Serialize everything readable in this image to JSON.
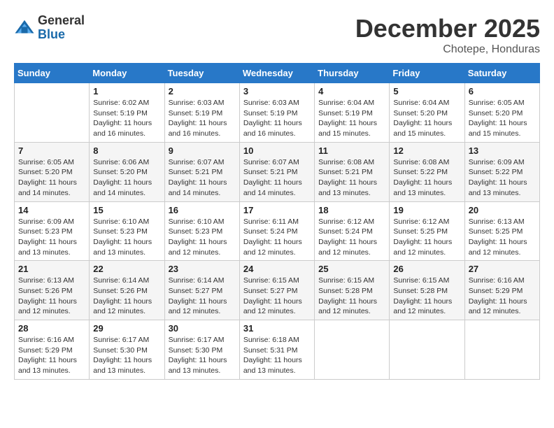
{
  "header": {
    "logo": {
      "general": "General",
      "blue": "Blue"
    },
    "title": "December 2025",
    "subtitle": "Chotepe, Honduras"
  },
  "calendar": {
    "days_of_week": [
      "Sunday",
      "Monday",
      "Tuesday",
      "Wednesday",
      "Thursday",
      "Friday",
      "Saturday"
    ],
    "weeks": [
      [
        {
          "day": "",
          "empty": true
        },
        {
          "day": "1",
          "sunrise": "6:02 AM",
          "sunset": "5:19 PM",
          "daylight": "11 hours and 16 minutes."
        },
        {
          "day": "2",
          "sunrise": "6:03 AM",
          "sunset": "5:19 PM",
          "daylight": "11 hours and 16 minutes."
        },
        {
          "day": "3",
          "sunrise": "6:03 AM",
          "sunset": "5:19 PM",
          "daylight": "11 hours and 16 minutes."
        },
        {
          "day": "4",
          "sunrise": "6:04 AM",
          "sunset": "5:19 PM",
          "daylight": "11 hours and 15 minutes."
        },
        {
          "day": "5",
          "sunrise": "6:04 AM",
          "sunset": "5:20 PM",
          "daylight": "11 hours and 15 minutes."
        },
        {
          "day": "6",
          "sunrise": "6:05 AM",
          "sunset": "5:20 PM",
          "daylight": "11 hours and 15 minutes."
        }
      ],
      [
        {
          "day": "7",
          "sunrise": "6:05 AM",
          "sunset": "5:20 PM",
          "daylight": "11 hours and 14 minutes."
        },
        {
          "day": "8",
          "sunrise": "6:06 AM",
          "sunset": "5:20 PM",
          "daylight": "11 hours and 14 minutes."
        },
        {
          "day": "9",
          "sunrise": "6:07 AM",
          "sunset": "5:21 PM",
          "daylight": "11 hours and 14 minutes."
        },
        {
          "day": "10",
          "sunrise": "6:07 AM",
          "sunset": "5:21 PM",
          "daylight": "11 hours and 14 minutes."
        },
        {
          "day": "11",
          "sunrise": "6:08 AM",
          "sunset": "5:21 PM",
          "daylight": "11 hours and 13 minutes."
        },
        {
          "day": "12",
          "sunrise": "6:08 AM",
          "sunset": "5:22 PM",
          "daylight": "11 hours and 13 minutes."
        },
        {
          "day": "13",
          "sunrise": "6:09 AM",
          "sunset": "5:22 PM",
          "daylight": "11 hours and 13 minutes."
        }
      ],
      [
        {
          "day": "14",
          "sunrise": "6:09 AM",
          "sunset": "5:23 PM",
          "daylight": "11 hours and 13 minutes."
        },
        {
          "day": "15",
          "sunrise": "6:10 AM",
          "sunset": "5:23 PM",
          "daylight": "11 hours and 13 minutes."
        },
        {
          "day": "16",
          "sunrise": "6:10 AM",
          "sunset": "5:23 PM",
          "daylight": "11 hours and 12 minutes."
        },
        {
          "day": "17",
          "sunrise": "6:11 AM",
          "sunset": "5:24 PM",
          "daylight": "11 hours and 12 minutes."
        },
        {
          "day": "18",
          "sunrise": "6:12 AM",
          "sunset": "5:24 PM",
          "daylight": "11 hours and 12 minutes."
        },
        {
          "day": "19",
          "sunrise": "6:12 AM",
          "sunset": "5:25 PM",
          "daylight": "11 hours and 12 minutes."
        },
        {
          "day": "20",
          "sunrise": "6:13 AM",
          "sunset": "5:25 PM",
          "daylight": "11 hours and 12 minutes."
        }
      ],
      [
        {
          "day": "21",
          "sunrise": "6:13 AM",
          "sunset": "5:26 PM",
          "daylight": "11 hours and 12 minutes."
        },
        {
          "day": "22",
          "sunrise": "6:14 AM",
          "sunset": "5:26 PM",
          "daylight": "11 hours and 12 minutes."
        },
        {
          "day": "23",
          "sunrise": "6:14 AM",
          "sunset": "5:27 PM",
          "daylight": "11 hours and 12 minutes."
        },
        {
          "day": "24",
          "sunrise": "6:15 AM",
          "sunset": "5:27 PM",
          "daylight": "11 hours and 12 minutes."
        },
        {
          "day": "25",
          "sunrise": "6:15 AM",
          "sunset": "5:28 PM",
          "daylight": "11 hours and 12 minutes."
        },
        {
          "day": "26",
          "sunrise": "6:15 AM",
          "sunset": "5:28 PM",
          "daylight": "11 hours and 12 minutes."
        },
        {
          "day": "27",
          "sunrise": "6:16 AM",
          "sunset": "5:29 PM",
          "daylight": "11 hours and 12 minutes."
        }
      ],
      [
        {
          "day": "28",
          "sunrise": "6:16 AM",
          "sunset": "5:29 PM",
          "daylight": "11 hours and 13 minutes."
        },
        {
          "day": "29",
          "sunrise": "6:17 AM",
          "sunset": "5:30 PM",
          "daylight": "11 hours and 13 minutes."
        },
        {
          "day": "30",
          "sunrise": "6:17 AM",
          "sunset": "5:30 PM",
          "daylight": "11 hours and 13 minutes."
        },
        {
          "day": "31",
          "sunrise": "6:18 AM",
          "sunset": "5:31 PM",
          "daylight": "11 hours and 13 minutes."
        },
        {
          "day": "",
          "empty": true
        },
        {
          "day": "",
          "empty": true
        },
        {
          "day": "",
          "empty": true
        }
      ]
    ],
    "labels": {
      "sunrise": "Sunrise:",
      "sunset": "Sunset:",
      "daylight": "Daylight:"
    }
  }
}
